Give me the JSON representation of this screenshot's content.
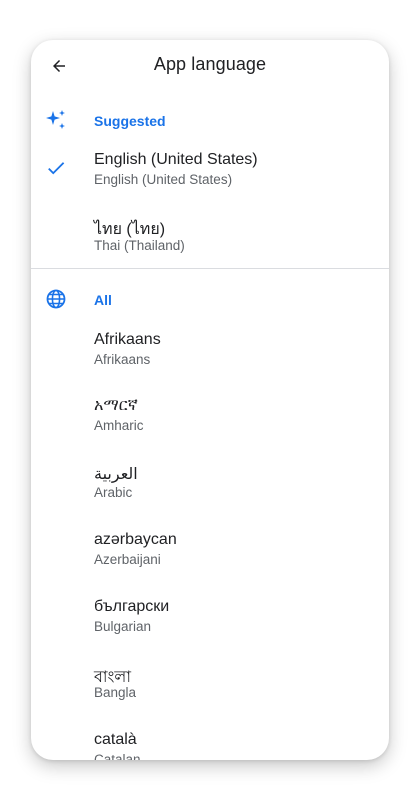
{
  "header": {
    "title": "App language",
    "back_icon": "arrow-back-icon"
  },
  "accent_color": "#1a73e8",
  "suggested": {
    "label": "Suggested",
    "icon": "sparkle-icon",
    "items": [
      {
        "name": "English (United States)",
        "subtitle": "English (United States)",
        "selected": true
      },
      {
        "name": "ไทย (ไทย)",
        "subtitle": "Thai (Thailand)",
        "selected": false
      }
    ]
  },
  "all": {
    "label": "All",
    "icon": "globe-icon",
    "items": [
      {
        "name": "Afrikaans",
        "subtitle": "Afrikaans"
      },
      {
        "name": "አማርኛ",
        "subtitle": "Amharic"
      },
      {
        "name": "العربية",
        "subtitle": "Arabic"
      },
      {
        "name": "azərbaycan",
        "subtitle": "Azerbaijani"
      },
      {
        "name": "български",
        "subtitle": "Bulgarian"
      },
      {
        "name": "বাংলা",
        "subtitle": "Bangla"
      },
      {
        "name": "català",
        "subtitle": "Catalan"
      }
    ]
  }
}
